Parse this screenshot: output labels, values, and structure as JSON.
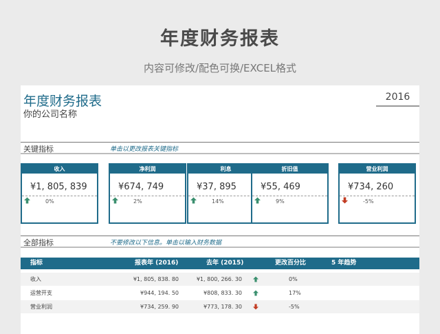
{
  "banner": {
    "title": "年度财务报表",
    "subtitle": "内容可修改/配色可换/EXCEL格式"
  },
  "report": {
    "title": "年度财务报表",
    "company": "你的公司名称",
    "year": "2016"
  },
  "key_section": {
    "label": "关键指标",
    "hint": "单击以更改报表关键指标"
  },
  "all_section": {
    "label": "全部指标",
    "hint": "不要修改以下信息。单击以输入财务数据"
  },
  "kpis": [
    {
      "name": "收入",
      "value": "¥1, 805, 839",
      "change": "0%",
      "direction": "up"
    },
    {
      "name": "净利润",
      "value": "¥674, 749",
      "change": "2%",
      "direction": "up"
    },
    {
      "name": "利息",
      "value": "¥37, 895",
      "change": "14%",
      "direction": "up"
    },
    {
      "name": "折旧值",
      "value": "¥55, 469",
      "change": "9%",
      "direction": "up"
    },
    {
      "name": "营业利润",
      "value": "¥734, 260",
      "change": "-5%",
      "direction": "down"
    }
  ],
  "table": {
    "headers": [
      "指标",
      "报表年 (2016)",
      "去年 (2015)",
      "更改百分比",
      "5 年趋势"
    ],
    "rows": [
      {
        "name": "收入",
        "current": "¥1, 805, 838. 80",
        "previous": "¥1, 800, 266. 30",
        "change": "0%",
        "direction": "up"
      },
      {
        "name": "运营开支",
        "current": "¥944, 194. 50",
        "previous": "¥808, 833. 30",
        "change": "17%",
        "direction": "up"
      },
      {
        "name": "营业利润",
        "current": "¥734, 259. 90",
        "previous": "¥773, 178. 30",
        "change": "-5%",
        "direction": "down"
      }
    ]
  },
  "colors": {
    "accent": "#1f6b8a",
    "up": "#3a8f6e",
    "down": "#c23b22"
  }
}
